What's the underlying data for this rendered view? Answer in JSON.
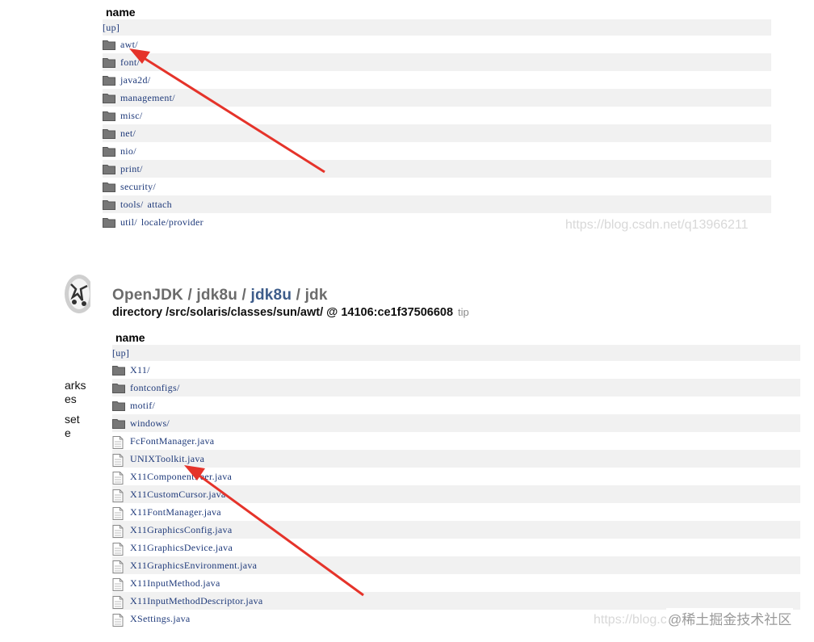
{
  "top_listing": {
    "header": "name",
    "up_label": "[up]",
    "entries": [
      {
        "label": "awt/",
        "extra": ""
      },
      {
        "label": "font/",
        "extra": ""
      },
      {
        "label": "java2d/",
        "extra": ""
      },
      {
        "label": "management/",
        "extra": ""
      },
      {
        "label": "misc/",
        "extra": ""
      },
      {
        "label": "net/",
        "extra": ""
      },
      {
        "label": "nio/",
        "extra": ""
      },
      {
        "label": "print/",
        "extra": ""
      },
      {
        "label": "security/",
        "extra": ""
      },
      {
        "label": "tools/",
        "extra": "attach"
      },
      {
        "label": "util/",
        "extra": "locale/provider"
      }
    ],
    "watermark": "https://blog.csdn.net/q13966211"
  },
  "banner": {
    "crumb_1": "OpenJDK",
    "sep": "/",
    "crumb_2": "jdk8u",
    "crumb_3": "jdk8u",
    "crumb_4": "jdk",
    "directory_line": "directory /src/solaris/classes/sun/awt/ @ 14106:ce1f37506608",
    "tip": "tip"
  },
  "sidebar_fragments": {
    "line1": "arks",
    "line2": "es",
    "line3": "set",
    "line4": "e"
  },
  "bottom_listing": {
    "header": "name",
    "up_label": "[up]",
    "folders": [
      "X11/",
      "fontconfigs/",
      "motif/",
      "windows/"
    ],
    "files": [
      "FcFontManager.java",
      "UNIXToolkit.java",
      "X11ComponentPeer.java",
      "X11CustomCursor.java",
      "X11FontManager.java",
      "X11GraphicsConfig.java",
      "X11GraphicsDevice.java",
      "X11GraphicsEnvironment.java",
      "X11InputMethod.java",
      "X11InputMethodDescriptor.java",
      "XSettings.java"
    ],
    "watermark": "https://blog.csdn.net/q13966211",
    "watermark2": "@稀土掘金技术社区"
  },
  "colors": {
    "link": "#1f3a7a",
    "row_alt": "#f1f1f1",
    "arrow": "#e5332a",
    "breadcrumb_current": "#3d5c8a"
  },
  "icons": {
    "folder": "folder-icon",
    "file": "file-icon"
  }
}
